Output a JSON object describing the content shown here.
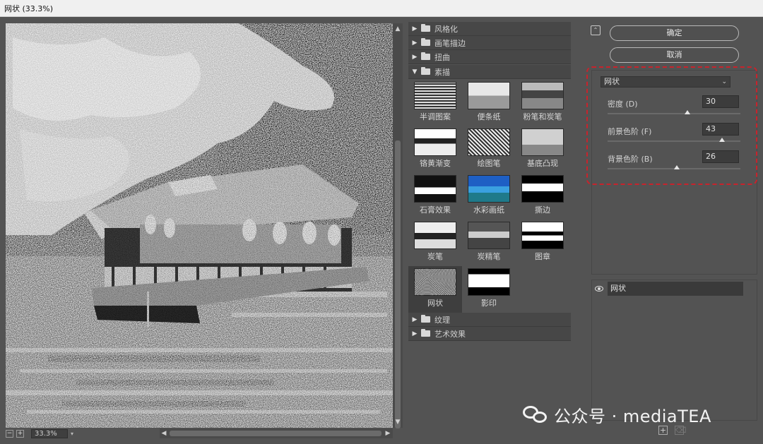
{
  "window": {
    "title": "网状 (33.3%)"
  },
  "preview": {
    "zoom": "33.3%",
    "zoom_minus": "−",
    "zoom_plus": "+"
  },
  "gallery": {
    "categories": [
      {
        "label": "风格化",
        "expanded": false
      },
      {
        "label": "画笔描边",
        "expanded": false
      },
      {
        "label": "扭曲",
        "expanded": false
      },
      {
        "label": "素描",
        "expanded": true
      },
      {
        "label": "纹理",
        "expanded": false
      },
      {
        "label": "艺术效果",
        "expanded": false
      }
    ],
    "filters": [
      {
        "label": "半调图案"
      },
      {
        "label": "便条纸"
      },
      {
        "label": "粉笔和炭笔"
      },
      {
        "label": "铬黄渐变"
      },
      {
        "label": "绘图笔"
      },
      {
        "label": "基底凸现"
      },
      {
        "label": "石膏效果"
      },
      {
        "label": "水彩画纸"
      },
      {
        "label": "撕边"
      },
      {
        "label": "炭笔"
      },
      {
        "label": "炭精笔"
      },
      {
        "label": "图章"
      },
      {
        "label": "网状",
        "selected": true
      },
      {
        "label": "影印"
      }
    ]
  },
  "actions": {
    "ok": "确定",
    "cancel": "取消"
  },
  "settings": {
    "filter": "网状",
    "params": [
      {
        "label": "密度 (D)",
        "value": "30",
        "fraction": 0.6
      },
      {
        "label": "前景色阶 (F)",
        "value": "43",
        "fraction": 0.86
      },
      {
        "label": "背景色阶 (B)",
        "value": "26",
        "fraction": 0.52
      }
    ]
  },
  "layers": {
    "items": [
      {
        "label": "网状"
      }
    ]
  },
  "watermark": {
    "text": "公众号 · mediaTEA"
  },
  "colors": {
    "highlight": "#c8232c",
    "panel": "#535353"
  }
}
